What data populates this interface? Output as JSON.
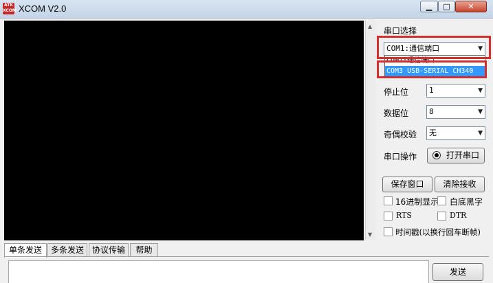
{
  "window": {
    "title": "XCOM V2.0",
    "logo_text_top": "ATK",
    "logo_text_bottom": "XCOM",
    "min_symbol": "▁",
    "max_symbol": "□",
    "close_symbol": "✕"
  },
  "sidebar": {
    "port_select_label": "串口选择",
    "port_selected": "COM1:通信端口",
    "port_options": [
      "COM1:通信端口",
      "COM3 USB-SERIAL CH340"
    ],
    "port_option_highlighted": "COM3 USB-SERIAL CH340",
    "stop_bits_label": "停止位",
    "stop_bits_value": "1",
    "data_bits_label": "数据位",
    "data_bits_value": "8",
    "parity_label": "奇偶校验",
    "parity_value": "无",
    "port_op_label": "串口操作",
    "open_port_button": "打开串口",
    "save_window_button": "保存窗口",
    "clear_receive_button": "清除接收",
    "hex_display_label": "16进制显示",
    "white_black_label": "白底黑字",
    "rts_label": "RTS",
    "dtr_label": "DTR",
    "timestamp_label": "时间戳(以换行回车断帧)"
  },
  "tabs": [
    "单条发送",
    "多条发送",
    "协议传输",
    "帮助"
  ],
  "send": {
    "send_button": "发送"
  },
  "colors": {
    "highlight": "#3399ff",
    "annotation_red": "#d32f2f",
    "terminal_bg": "#000000"
  }
}
